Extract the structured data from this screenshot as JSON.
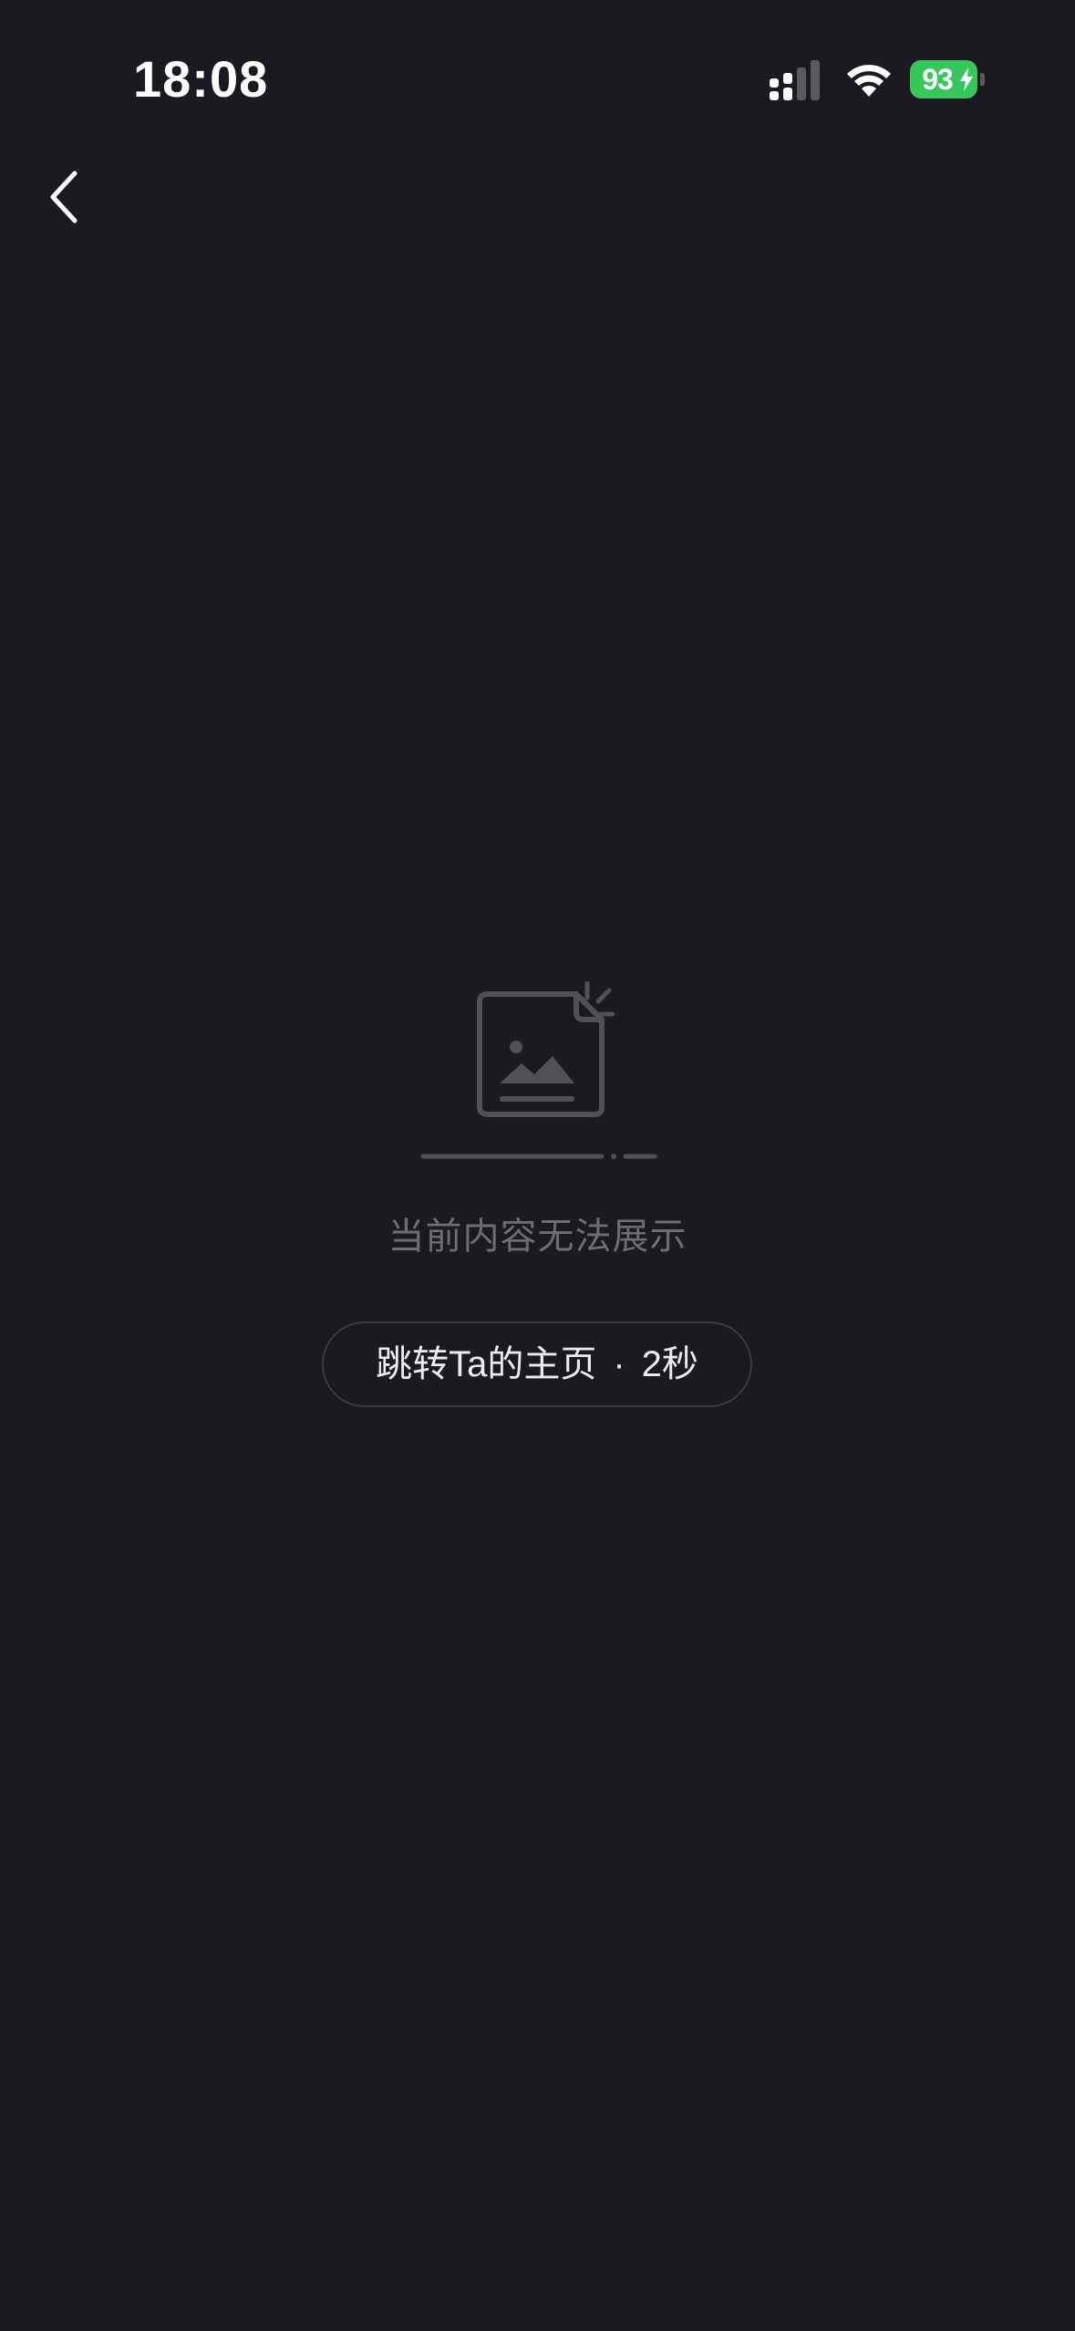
{
  "status_bar": {
    "time": "18:08",
    "battery_level": "93",
    "battery_charging": true,
    "signal_icon": "cellular-signal-icon",
    "wifi_icon": "wifi-icon",
    "battery_color": "#34c759"
  },
  "nav": {
    "back_icon": "chevron-left-icon"
  },
  "empty_state": {
    "illustration_icon": "broken-image-document-icon",
    "message": "当前内容无法展示"
  },
  "jump_button": {
    "label": "跳转Ta的主页",
    "separator": "·",
    "countdown": "2秒"
  },
  "colors": {
    "background": "#1b1a20",
    "muted_text": "#6e6d73",
    "button_border": "#3b3a40",
    "button_text": "#ececee"
  }
}
